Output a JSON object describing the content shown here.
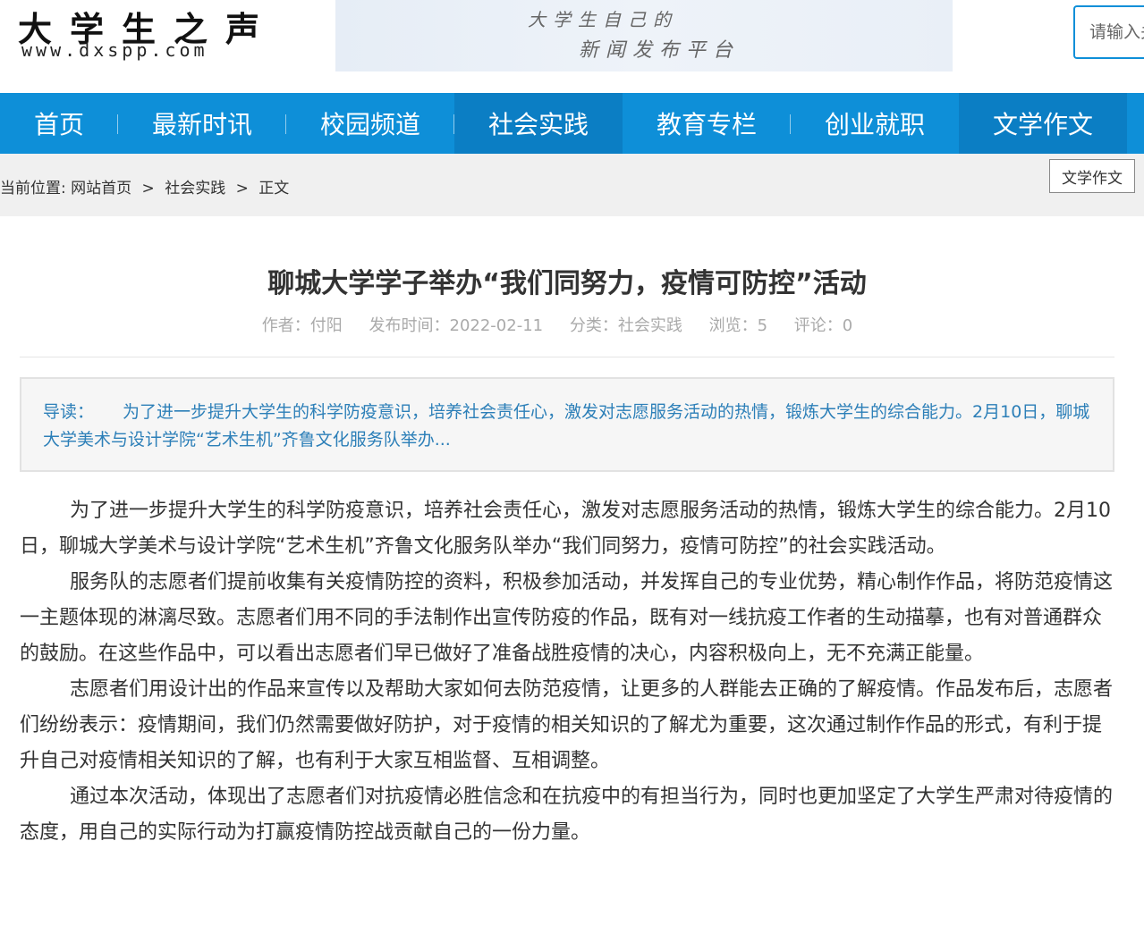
{
  "header": {
    "logo_cn": "大学生之声",
    "logo_url": "www.dxspp.com",
    "banner_line1": "大学生自己的",
    "banner_line2": "新闻发布平台",
    "search_placeholder": "请输入关键词"
  },
  "nav": {
    "items": [
      {
        "label": "首页"
      },
      {
        "label": "最新时讯"
      },
      {
        "label": "校园频道"
      },
      {
        "label": "社会实践"
      },
      {
        "label": "教育专栏"
      },
      {
        "label": "创业就职"
      },
      {
        "label": "文学作文"
      }
    ]
  },
  "breadcrumb": {
    "prefix": "当前位置:",
    "home": "网站首页",
    "sep": ">",
    "category": "社会实践",
    "current": "正文"
  },
  "side_tab": "文学作文",
  "article": {
    "title": "聊城大学学子举办“我们同努力，疫情可防控”活动",
    "meta": {
      "author": "作者：付阳",
      "date": "发布时间：2022-02-11",
      "category": "分类：社会实践",
      "views": "浏览：5",
      "comments": "评论：0"
    },
    "summary_label": "导读：",
    "summary_text": "为了进一步提升大学生的科学防疫意识，培养社会责任心，激发对志愿服务活动的热情，锻炼大学生的综合能力。2月10日，聊城大学美术与设计学院“艺术生机”齐鲁文化服务队举办...",
    "paragraphs": [
      "为了进一步提升大学生的科学防疫意识，培养社会责任心，激发对志愿服务活动的热情，锻炼大学生的综合能力。2月10日，聊城大学美术与设计学院“艺术生机”齐鲁文化服务队举办“我们同努力，疫情可防控”的社会实践活动。",
      "服务队的志愿者们提前收集有关疫情防控的资料，积极参加活动，并发挥自己的专业优势，精心制作作品，将防范疫情这一主题体现的淋漓尽致。志愿者们用不同的手法制作出宣传防疫的作品，既有对一线抗疫工作者的生动描摹，也有对普通群众的鼓励。在这些作品中，可以看出志愿者们早已做好了准备战胜疫情的决心，内容积极向上，无不充满正能量。",
      "志愿者们用设计出的作品来宣传以及帮助大家如何去防范疫情，让更多的人群能去正确的了解疫情。作品发布后，志愿者们纷纷表示：疫情期间，我们仍然需要做好防护，对于疫情的相关知识的了解尤为重要，这次通过制作作品的形式，有利于提升自己对疫情相关知识的了解，也有利于大家互相监督、互相调整。",
      "通过本次活动，体现出了志愿者们对抗疫情必胜信念和在抗疫中的有担当行为，同时也更加坚定了大学生严肃对待疫情的态度，用自己的实际行动为打赢疫情防控战贡献自己的一份力量。"
    ]
  },
  "colors": {
    "nav_bg": "#0e8fd8",
    "nav_active": "#0b7ec4",
    "summary_text": "#2c7fb8"
  }
}
